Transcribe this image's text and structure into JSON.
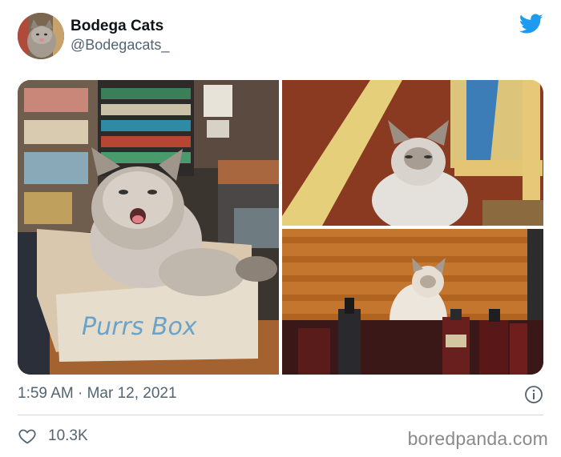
{
  "author": {
    "display_name": "Bodega Cats",
    "handle": "@Bodegacats_",
    "avatar": "cat-avatar"
  },
  "brand": {
    "logo": "twitter-bird-icon",
    "color": "#1d9bf0"
  },
  "media": {
    "count": 3,
    "box_text": "Purrs Box"
  },
  "footer": {
    "timestamp": "1:59 AM · Mar 12, 2021",
    "likes": "10.3K"
  },
  "watermark": "boredpanda.com",
  "colors": {
    "text_primary": "#0f1419",
    "text_secondary": "#536471",
    "divider": "#cfd9de"
  }
}
